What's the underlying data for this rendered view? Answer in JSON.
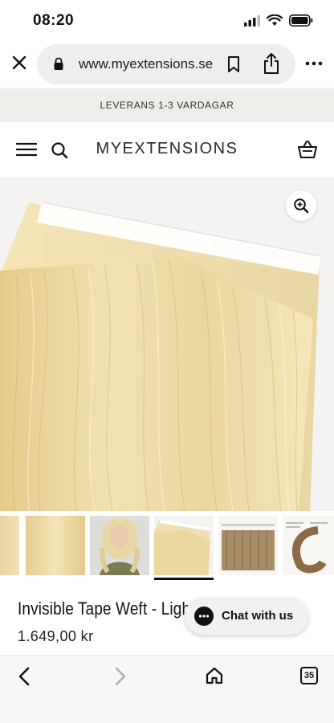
{
  "status_bar": {
    "time": "08:20"
  },
  "browser": {
    "url": "www.myextensions.se",
    "icons": [
      "close-icon",
      "lock-icon",
      "bookmark-icon",
      "share-icon",
      "more-icon"
    ]
  },
  "announcement": {
    "text": "LEVERANS 1-3 VARDAGAR"
  },
  "site_header": {
    "logo": "MYEXTENSIONS",
    "icons": [
      "menu-icon",
      "search-icon",
      "cart-icon"
    ]
  },
  "hero": {
    "zoom_icon": "zoom-in-icon",
    "image_alt": "blonde tape weft hair extension"
  },
  "thumbnails": {
    "count": 6,
    "active_index": 3
  },
  "product": {
    "title": "Invisible Tape Weft - Light",
    "price": "1.649,00 kr"
  },
  "chat": {
    "label": "Chat with us"
  },
  "bottom_toolbar": {
    "tab_count": "35"
  },
  "colors": {
    "announce_bg": "#efedea",
    "hair_light": "#f1e1ad",
    "hair_dark": "#d8bf7f",
    "accent": "#111111"
  }
}
